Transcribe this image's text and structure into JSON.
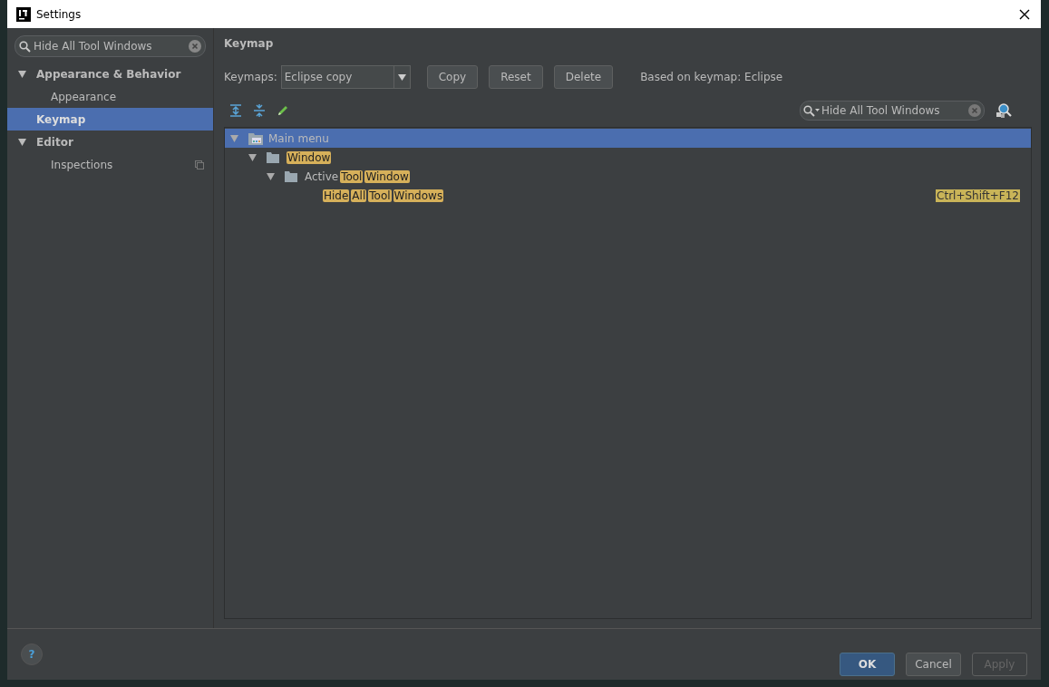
{
  "window": {
    "title": "Settings"
  },
  "sidebar": {
    "search": {
      "value": "Hide All Tool Windows"
    },
    "items": [
      {
        "label": "Appearance & Behavior",
        "expanded": true,
        "selected": false,
        "children": [
          {
            "label": "Appearance",
            "selected": false,
            "project_level": false
          }
        ]
      },
      {
        "label": "Keymap",
        "selected": true
      },
      {
        "label": "Editor",
        "expanded": true,
        "selected": false,
        "children": [
          {
            "label": "Inspections",
            "selected": false,
            "project_level": true
          }
        ]
      }
    ]
  },
  "page": {
    "title": "Keymap",
    "keymaps_label": "Keymaps:",
    "keymap_value": "Eclipse copy",
    "buttons": [
      {
        "label": "Copy",
        "disabled": false
      },
      {
        "label": "Reset",
        "disabled": false
      },
      {
        "label": "Delete",
        "disabled": false
      }
    ],
    "based_on": "Based on keymap: Eclipse",
    "filter": {
      "value": "Hide All Tool Windows"
    },
    "tree": [
      {
        "kind": "menu",
        "selected": true,
        "expanded": true,
        "segments": [
          {
            "text": "Main menu",
            "match": false
          }
        ],
        "children": [
          {
            "kind": "folder",
            "selected": false,
            "expanded": true,
            "segments": [
              {
                "text": "Window",
                "match": true
              }
            ],
            "children": [
              {
                "kind": "folder",
                "selected": false,
                "expanded": true,
                "segments": [
                  {
                    "text": "Active",
                    "match": false
                  },
                  {
                    "text": "Tool",
                    "match": true
                  },
                  {
                    "text": "Window",
                    "match": true
                  }
                ],
                "children": [
                  {
                    "selected": false,
                    "segments": [
                      {
                        "text": "Hide",
                        "match": true
                      },
                      {
                        "text": "All",
                        "match": true
                      },
                      {
                        "text": "Tool",
                        "match": true
                      },
                      {
                        "text": "Windows",
                        "match": true
                      }
                    ],
                    "shortcut": "Ctrl+Shift+F12"
                  }
                ]
              }
            ]
          }
        ]
      }
    ]
  },
  "footer": {
    "help": "?",
    "buttons": [
      {
        "label": "OK",
        "kind": "default",
        "disabled": false
      },
      {
        "label": "Cancel",
        "kind": "normal",
        "disabled": false
      },
      {
        "label": "Apply",
        "kind": "normal",
        "disabled": true
      }
    ]
  }
}
